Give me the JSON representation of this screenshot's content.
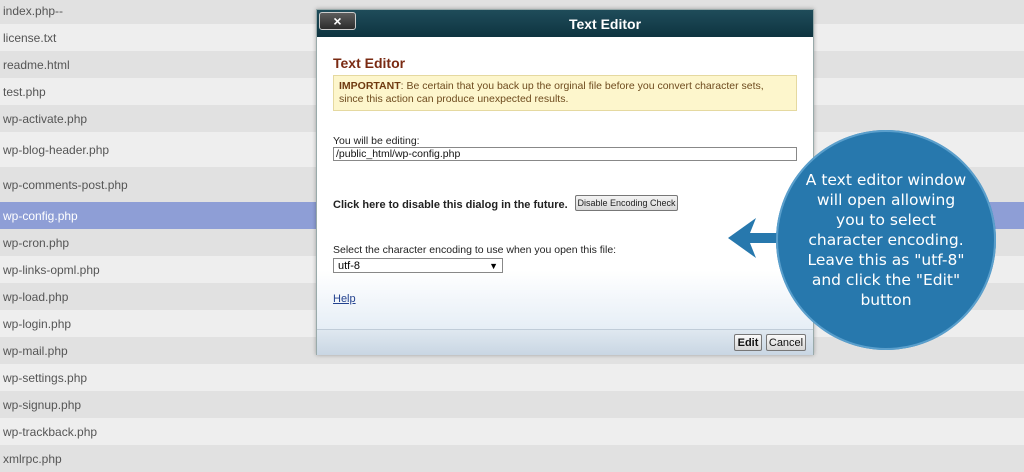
{
  "file_list": [
    "index.php--",
    "license.txt",
    "readme.html",
    "test.php",
    "wp-activate.php",
    "wp-blog-header.php",
    "wp-comments-post.php",
    "wp-config.php",
    "wp-cron.php",
    "wp-links-opml.php",
    "wp-load.php",
    "wp-login.php",
    "wp-mail.php",
    "wp-settings.php",
    "wp-signup.php",
    "wp-trackback.php",
    "xmlrpc.php"
  ],
  "selected_file": "wp-config.php",
  "dialog": {
    "title": "Text Editor",
    "close_label": "×",
    "heading": "Text Editor",
    "warning_strong": "IMPORTANT",
    "warning_text": ": Be certain that you back up the orginal file before you convert character sets, since this action can produce unexpected results.",
    "editing_label": "You will be editing:",
    "editing_path": "/public_html/wp-config.php",
    "disable_text": "Click here to disable this dialog in the future.",
    "disable_button": "Disable Encoding Check",
    "encoding_label": "Select the character encoding to use when you open this file:",
    "encoding_value": "utf-8",
    "help_link": "Help",
    "edit_button": "Edit",
    "cancel_button": "Cancel"
  },
  "callout": {
    "text": "A text editor window will open allowing you to select character encoding. Leave this as \"utf-8\" and click the \"Edit\" button"
  },
  "colors": {
    "selected_row": "#8e9ed6",
    "callout": "#2778ad",
    "titlebar": "#0e3440"
  }
}
